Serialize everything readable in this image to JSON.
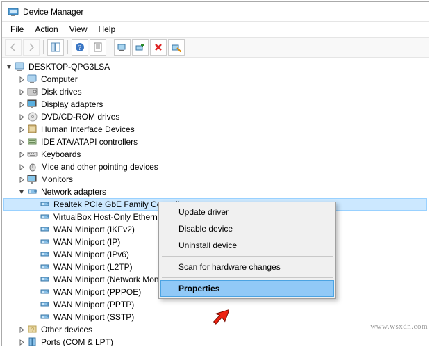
{
  "window": {
    "title": "Device Manager"
  },
  "menubar": {
    "file": "File",
    "action": "Action",
    "view": "View",
    "help": "Help"
  },
  "root": {
    "name": "DESKTOP-QPG3LSA"
  },
  "categories": [
    {
      "label": "Computer",
      "expanded": false
    },
    {
      "label": "Disk drives",
      "expanded": false
    },
    {
      "label": "Display adapters",
      "expanded": false
    },
    {
      "label": "DVD/CD-ROM drives",
      "expanded": false
    },
    {
      "label": "Human Interface Devices",
      "expanded": false
    },
    {
      "label": "IDE ATA/ATAPI controllers",
      "expanded": false
    },
    {
      "label": "Keyboards",
      "expanded": false
    },
    {
      "label": "Mice and other pointing devices",
      "expanded": false
    },
    {
      "label": "Monitors",
      "expanded": false
    },
    {
      "label": "Network adapters",
      "expanded": true
    },
    {
      "label": "Other devices",
      "expanded": false
    },
    {
      "label": "Ports (COM & LPT)",
      "expanded": false
    }
  ],
  "network_devices": [
    "Realtek PCIe GbE Family Controller",
    "VirtualBox Host-Only Ethernet Adapter",
    "WAN Miniport (IKEv2)",
    "WAN Miniport (IP)",
    "WAN Miniport (IPv6)",
    "WAN Miniport (L2TP)",
    "WAN Miniport (Network Monitor)",
    "WAN Miniport (PPPOE)",
    "WAN Miniport (PPTP)",
    "WAN Miniport (SSTP)"
  ],
  "context_menu": {
    "update": "Update driver",
    "disable": "Disable device",
    "uninstall": "Uninstall device",
    "scan": "Scan for hardware changes",
    "properties": "Properties"
  },
  "watermark": "www.wsxdn.com"
}
